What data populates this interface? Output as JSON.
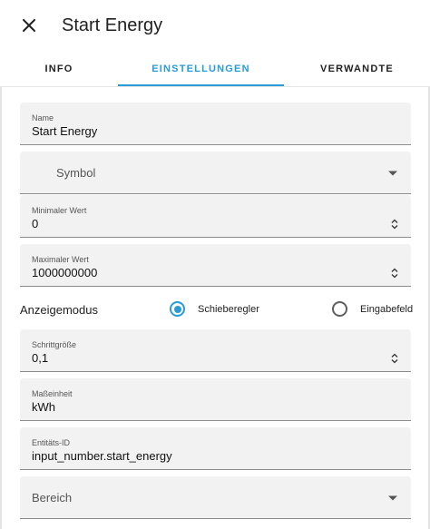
{
  "dialog": {
    "title": "Start Energy"
  },
  "tabs": [
    {
      "label": "INFO"
    },
    {
      "label": "EINSTELLUNGEN"
    },
    {
      "label": "VERWANDTE"
    }
  ],
  "fields": {
    "name": {
      "label": "Name",
      "value": "Start Energy"
    },
    "symbol": {
      "placeholder": "Symbol"
    },
    "min": {
      "label": "Minimaler Wert",
      "value": "0"
    },
    "max": {
      "label": "Maximaler Wert",
      "value": "1000000000"
    },
    "step": {
      "label": "Schrittgröße",
      "value": "0,1"
    },
    "unit": {
      "label": "Maßeinheit",
      "value": "kWh"
    },
    "entity": {
      "label": "Entitäts-ID",
      "value": "input_number.start_energy"
    },
    "area": {
      "placeholder": "Bereich"
    }
  },
  "mode": {
    "label": "Anzeigemodus",
    "options": [
      {
        "label": "Schieberegler",
        "selected": true
      },
      {
        "label": "Eingabefeld",
        "selected": false
      }
    ]
  },
  "colors": {
    "accent": "#2a9bd6",
    "field_bg": "#f2f2f2"
  }
}
